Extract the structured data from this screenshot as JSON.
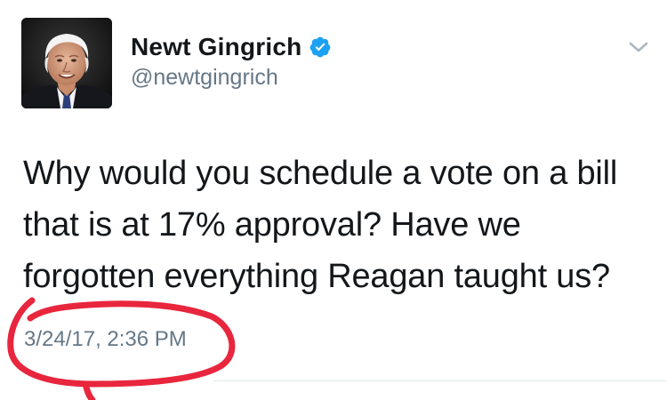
{
  "tweet": {
    "author": {
      "display_name": "Newt Gingrich",
      "handle": "@newtgingrich",
      "verified": true
    },
    "text": "Why would you schedule a vote on a bill that is at 17% approval? Have we forgotten everything Reagan taught us?",
    "timestamp": "3/24/17, 2:36 PM"
  },
  "icons": {
    "verified": "verified-badge-icon",
    "caret": "chevron-down-icon"
  },
  "colors": {
    "verified_blue": "#1da1f2",
    "secondary_text": "#657786",
    "primary_text": "#14171a",
    "annotation_red": "#e8263d"
  }
}
